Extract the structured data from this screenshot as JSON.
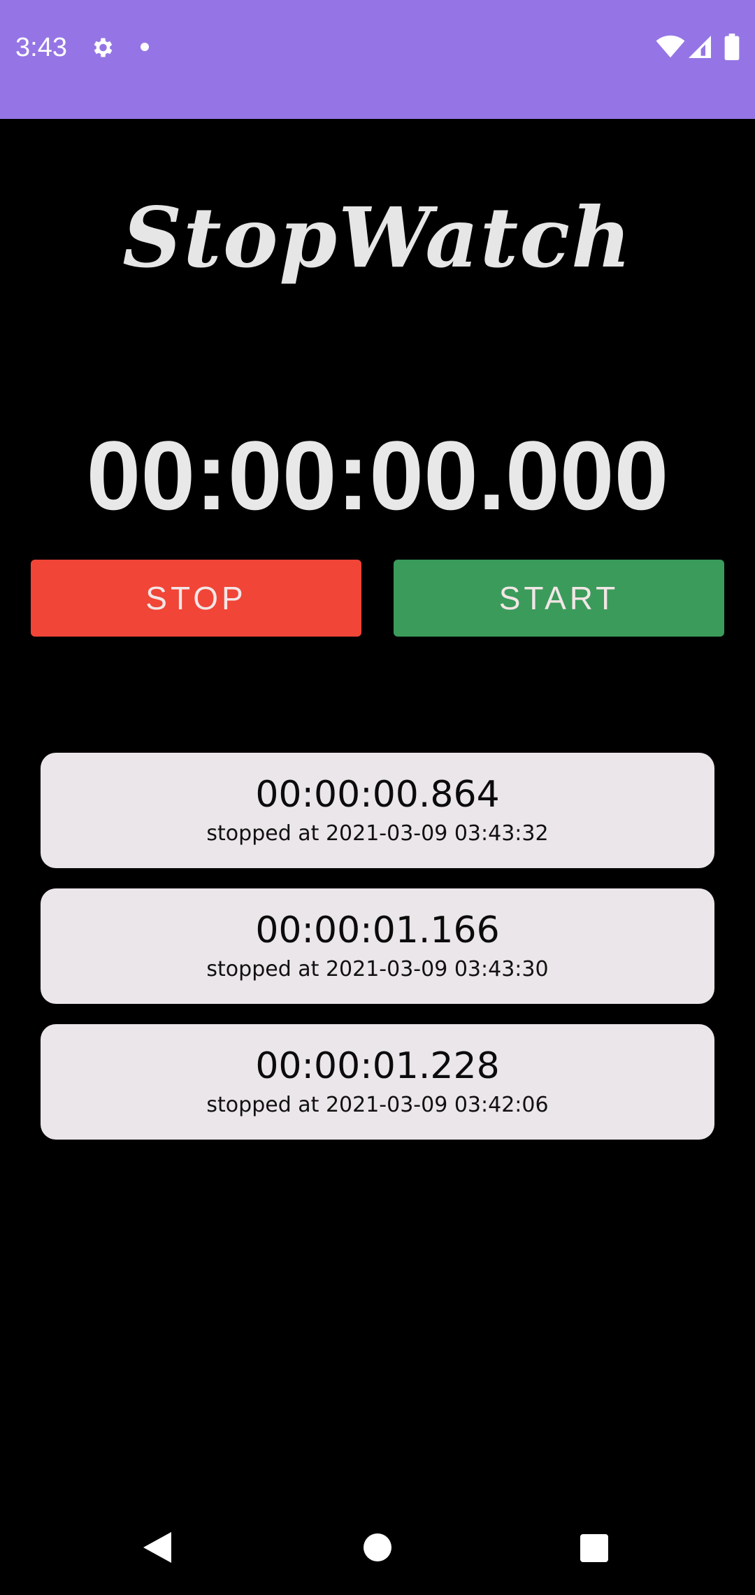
{
  "status_bar": {
    "time": "3:43",
    "icons": [
      "gear-icon",
      "notification-dot-icon",
      "wifi-icon",
      "signal-icon",
      "battery-icon"
    ],
    "background": "#9575e5"
  },
  "app": {
    "title": "StopWatch"
  },
  "timer": {
    "display": "00:00:00.000"
  },
  "controls": {
    "stop_label": "STOP",
    "start_label": "START",
    "stop_color": "#f04537",
    "start_color": "#3b9b5b"
  },
  "laps": [
    {
      "time": "00:00:00.864",
      "stamp": "stopped at 2021-03-09 03:43:32"
    },
    {
      "time": "00:00:01.166",
      "stamp": "stopped at 2021-03-09 03:43:30"
    },
    {
      "time": "00:00:01.228",
      "stamp": "stopped at 2021-03-09 03:42:06"
    }
  ],
  "nav_bar": {
    "icons": [
      "back-icon",
      "home-icon",
      "recents-icon"
    ]
  }
}
